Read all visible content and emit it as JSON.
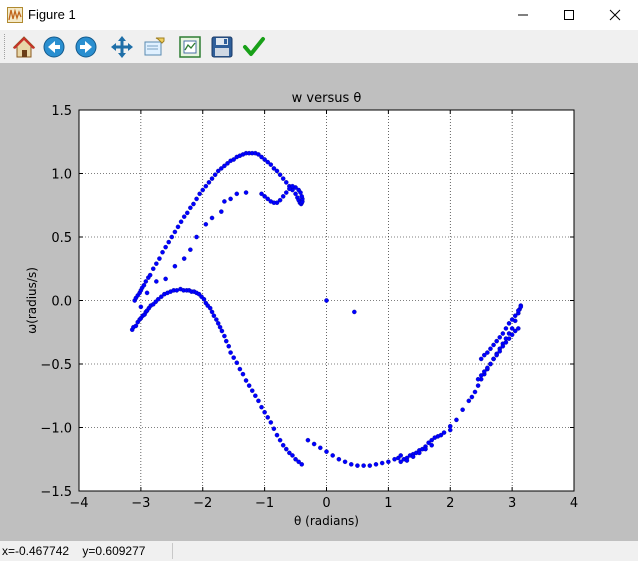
{
  "window": {
    "title": "Figure 1",
    "controls": {
      "minimize": "minimize",
      "maximize": "maximize",
      "close": "close"
    }
  },
  "toolbar": {
    "buttons": [
      {
        "name": "home",
        "icon": "home-icon"
      },
      {
        "name": "back",
        "icon": "back-arrow-icon"
      },
      {
        "name": "forward",
        "icon": "forward-arrow-icon"
      },
      {
        "name": "pan",
        "icon": "move-arrows-icon"
      },
      {
        "name": "zoom",
        "icon": "zoom-rect-icon"
      },
      {
        "name": "subplots",
        "icon": "configure-subplots-icon"
      },
      {
        "name": "save",
        "icon": "floppy-disk-icon"
      },
      {
        "name": "edit",
        "icon": "checkmark-icon"
      }
    ]
  },
  "status": {
    "coords": "x=-0.467742    y=0.609277"
  },
  "colors": {
    "series": "#0000ff",
    "canvas_bg": "#bfbfbf",
    "plot_bg": "#ffffff"
  },
  "chart_data": {
    "type": "scatter",
    "title": "w versus θ",
    "xlabel": "θ (radians)",
    "ylabel": "ω(radius/s)",
    "xlim": [
      -4,
      4
    ],
    "ylim": [
      -1.5,
      1.5
    ],
    "xticks": [
      -4,
      -3,
      -2,
      -1,
      0,
      1,
      2,
      3,
      4
    ],
    "yticks": [
      -1.5,
      -1.0,
      -0.5,
      0.0,
      0.5,
      1.0,
      1.5
    ],
    "xtick_labels": [
      "−4",
      "−3",
      "−2",
      "−1",
      "0",
      "1",
      "2",
      "3",
      "4"
    ],
    "ytick_labels": [
      "−1.5",
      "−1.0",
      "−0.5",
      "0.0",
      "0.5",
      "1.0",
      "1.5"
    ],
    "grid": true,
    "marker": "circle",
    "series": [
      {
        "x": [
          -3.14,
          -3.12,
          -3.08,
          -3.05,
          -3.02,
          -3.0,
          -2.97,
          -2.94,
          -2.92,
          -2.9,
          -2.87,
          -2.84,
          -2.8,
          -2.76,
          -2.72,
          -2.67,
          -2.62,
          -2.57,
          -2.52,
          -2.47,
          -2.42,
          -2.36,
          -2.31,
          -2.26,
          -2.22,
          -2.18,
          -2.14,
          -2.1,
          -2.06,
          -2.02,
          -1.98,
          -1.95,
          -1.92,
          -1.88,
          -1.85,
          -1.82,
          -1.78,
          -1.75,
          -1.72,
          -1.69,
          -1.65,
          -1.62,
          -1.58,
          -1.55,
          -1.5,
          -1.45,
          -1.4,
          -1.35,
          -1.3,
          -1.25,
          -1.2,
          -1.15,
          -1.1,
          -1.05,
          -1.0,
          -0.95,
          -0.9,
          -0.85,
          -0.8,
          -0.75,
          -0.7,
          -0.65,
          -0.6,
          -0.55,
          -0.5,
          -0.45,
          -0.4,
          -0.3,
          -0.2,
          -0.1,
          0.0,
          0.1,
          0.2,
          0.3,
          0.4,
          0.5,
          0.6,
          0.7,
          0.8,
          0.9,
          1.0,
          1.1,
          1.16,
          1.2
        ],
        "y": [
          -0.23,
          -0.21,
          -0.2,
          -0.17,
          -0.15,
          -0.14,
          -0.12,
          -0.11,
          -0.09,
          -0.08,
          -0.06,
          -0.04,
          -0.03,
          -0.01,
          0.01,
          0.03,
          0.05,
          0.06,
          0.07,
          0.08,
          0.08,
          0.09,
          0.08,
          0.08,
          0.08,
          0.07,
          0.07,
          0.06,
          0.05,
          0.03,
          0.01,
          -0.02,
          -0.04,
          -0.06,
          -0.09,
          -0.12,
          -0.15,
          -0.18,
          -0.21,
          -0.24,
          -0.28,
          -0.32,
          -0.36,
          -0.41,
          -0.45,
          -0.49,
          -0.54,
          -0.58,
          -0.63,
          -0.67,
          -0.71,
          -0.75,
          -0.79,
          -0.84,
          -0.88,
          -0.92,
          -0.96,
          -1.01,
          -1.06,
          -1.1,
          -1.14,
          -1.17,
          -1.2,
          -1.22,
          -1.25,
          -1.27,
          -1.29,
          -1.1,
          -1.13,
          -1.16,
          -1.19,
          -1.22,
          -1.25,
          -1.27,
          -1.29,
          -1.3,
          -1.3,
          -1.3,
          -1.29,
          -1.28,
          -1.27,
          -1.25,
          -1.24,
          -1.22
        ]
      },
      {
        "x": [
          -3.1,
          -3.08,
          -3.05,
          -3.02,
          -3.0,
          -2.98,
          -2.95,
          -2.92,
          -2.88,
          -2.85,
          -2.8,
          -2.75,
          -2.7,
          -2.65,
          -2.6,
          -2.55,
          -2.5,
          -2.45,
          -2.4,
          -2.35,
          -2.3,
          -2.25,
          -2.2,
          -2.15,
          -2.1,
          -2.05,
          -2.0,
          -1.95,
          -1.9,
          -1.85,
          -1.8,
          -1.75,
          -1.7,
          -1.65,
          -1.6,
          -1.55,
          -1.5,
          -1.45,
          -1.4,
          -1.35,
          -1.3,
          -1.25,
          -1.2,
          -1.15,
          -1.1,
          -1.05,
          -1.0,
          -0.95,
          -0.9,
          -0.85,
          -0.8,
          -0.75,
          -0.7,
          -0.65,
          -0.6,
          -0.55,
          -0.5,
          -0.47,
          -0.45,
          -0.43,
          -0.41,
          -0.4,
          -0.39,
          -0.39,
          -0.4,
          -0.42,
          -0.45,
          -0.5,
          -0.55,
          -0.6,
          -0.65,
          -0.7,
          -0.75,
          -0.8,
          -0.85,
          -0.9,
          -0.95,
          -1.0,
          -1.05,
          -1.3,
          -1.45,
          -1.55,
          -1.65,
          -1.7,
          -1.85,
          -1.95,
          -2.1,
          -2.2,
          -2.3,
          -2.45,
          -2.6,
          -2.75,
          -2.9,
          -3.0
        ],
        "y": [
          0.0,
          0.02,
          0.04,
          0.06,
          0.08,
          0.1,
          0.12,
          0.15,
          0.18,
          0.2,
          0.25,
          0.29,
          0.33,
          0.38,
          0.42,
          0.46,
          0.5,
          0.54,
          0.58,
          0.62,
          0.66,
          0.69,
          0.73,
          0.76,
          0.8,
          0.84,
          0.87,
          0.9,
          0.93,
          0.96,
          0.99,
          1.02,
          1.04,
          1.06,
          1.08,
          1.1,
          1.11,
          1.13,
          1.14,
          1.15,
          1.16,
          1.16,
          1.16,
          1.16,
          1.15,
          1.13,
          1.11,
          1.09,
          1.07,
          1.04,
          1.02,
          0.99,
          0.96,
          0.93,
          0.9,
          0.87,
          0.84,
          0.81,
          0.79,
          0.77,
          0.76,
          0.77,
          0.78,
          0.8,
          0.82,
          0.85,
          0.87,
          0.89,
          0.9,
          0.88,
          0.85,
          0.82,
          0.79,
          0.77,
          0.77,
          0.78,
          0.8,
          0.82,
          0.84,
          0.85,
          0.84,
          0.8,
          0.78,
          0.7,
          0.65,
          0.6,
          0.5,
          0.4,
          0.33,
          0.27,
          0.17,
          0.15,
          0.06,
          -0.05
        ]
      },
      {
        "x": [
          1.2,
          1.25,
          1.3,
          1.35,
          1.4,
          1.45,
          1.5,
          1.55,
          1.6,
          1.65,
          1.7,
          1.8,
          1.9,
          2.0,
          2.1,
          2.2,
          2.3,
          2.35,
          2.4,
          2.45,
          2.5,
          2.55,
          2.6,
          2.65,
          2.7,
          2.75,
          2.8,
          2.85,
          2.9,
          2.95,
          3.0,
          3.05,
          3.1,
          3.12,
          3.14,
          2.5,
          2.55,
          2.6,
          2.65,
          2.7,
          2.75,
          2.8,
          2.85,
          2.9,
          2.95,
          3.0,
          3.05,
          3.1,
          3.14,
          2.45,
          2.5,
          2.55,
          2.6,
          2.65,
          2.7,
          2.75,
          2.8,
          2.85,
          2.9,
          2.95,
          3.0,
          3.05,
          3.1,
          1.3,
          1.4,
          1.5,
          1.6,
          1.7,
          1.75,
          1.85,
          2.0,
          0.0,
          0.45
        ],
        "y": [
          -1.27,
          -1.25,
          -1.24,
          -1.22,
          -1.21,
          -1.2,
          -1.18,
          -1.17,
          -1.15,
          -1.12,
          -1.1,
          -1.07,
          -1.04,
          -0.99,
          -0.94,
          -0.86,
          -0.79,
          -0.76,
          -0.72,
          -0.67,
          -0.62,
          -0.58,
          -0.54,
          -0.5,
          -0.46,
          -0.42,
          -0.38,
          -0.34,
          -0.3,
          -0.26,
          -0.22,
          -0.16,
          -0.1,
          -0.07,
          -0.04,
          -0.46,
          -0.43,
          -0.41,
          -0.38,
          -0.35,
          -0.32,
          -0.29,
          -0.26,
          -0.22,
          -0.18,
          -0.15,
          -0.12,
          -0.08,
          -0.05,
          -0.62,
          -0.59,
          -0.56,
          -0.53,
          -0.5,
          -0.46,
          -0.43,
          -0.4,
          -0.36,
          -0.33,
          -0.3,
          -0.27,
          -0.24,
          -0.22,
          -1.26,
          -1.23,
          -1.2,
          -1.17,
          -1.14,
          -1.08,
          -1.06,
          -1.02,
          0.0,
          -0.09
        ]
      }
    ]
  }
}
